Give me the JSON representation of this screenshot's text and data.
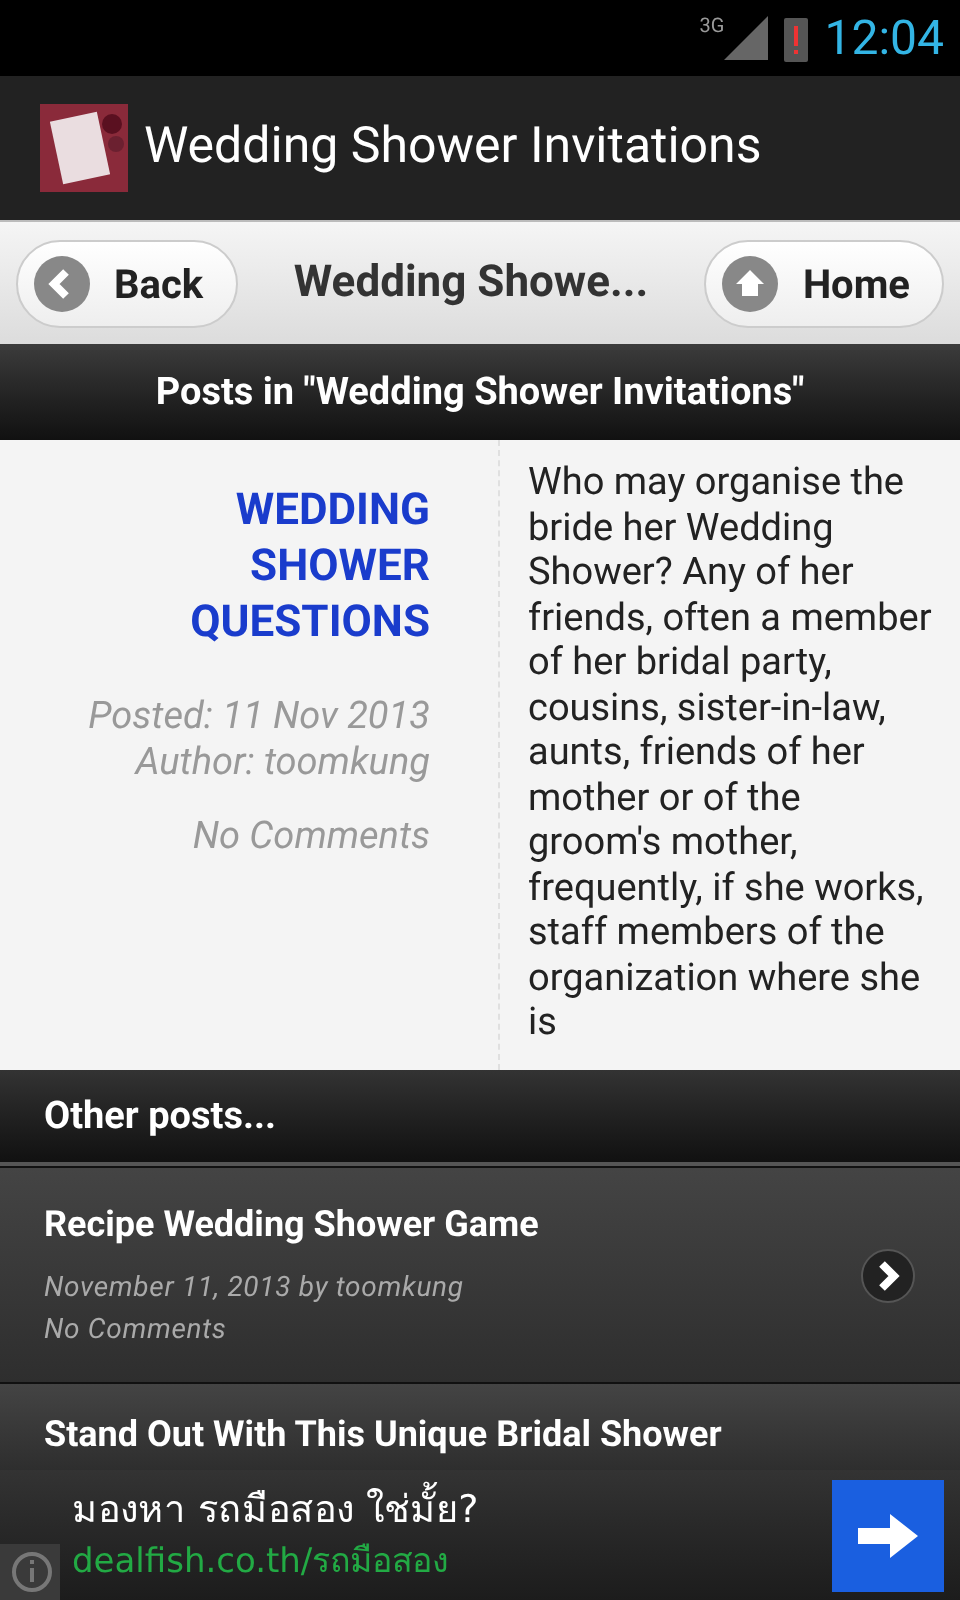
{
  "status_bar": {
    "network": "3G",
    "time": "12:04"
  },
  "app_bar": {
    "title": "Wedding Shower Invitations"
  },
  "nav_bar": {
    "back": "Back",
    "title": "Wedding Showe...",
    "home": "Home"
  },
  "posts_header": "Posts in \"Wedding Shower Invitations\"",
  "post": {
    "title": "WEDDING SHOWER QUESTIONS",
    "posted": "Posted: 11 Nov 2013",
    "author": "Author: toomkung",
    "comments": "No Comments",
    "excerpt": "Who may organise the bride her Wedding Shower? Any of her friends, often a member of her bridal party, cousins, sister-in-law, aunts, friends of her mother or of the groom's mother, frequently, if she works, staff members of the organization where she is"
  },
  "other_posts": {
    "title": "Other posts...",
    "items": [
      {
        "title": "Recipe Wedding Shower Game",
        "meta": "November 11, 2013 by toomkung",
        "comments": "No Comments"
      },
      {
        "title": "Stand Out With This Unique Bridal Shower"
      }
    ]
  },
  "ad": {
    "headline": "มองหา รถมือสอง ใช่มั้ย?",
    "url": "dealfish.co.th/รถมือสอง"
  }
}
